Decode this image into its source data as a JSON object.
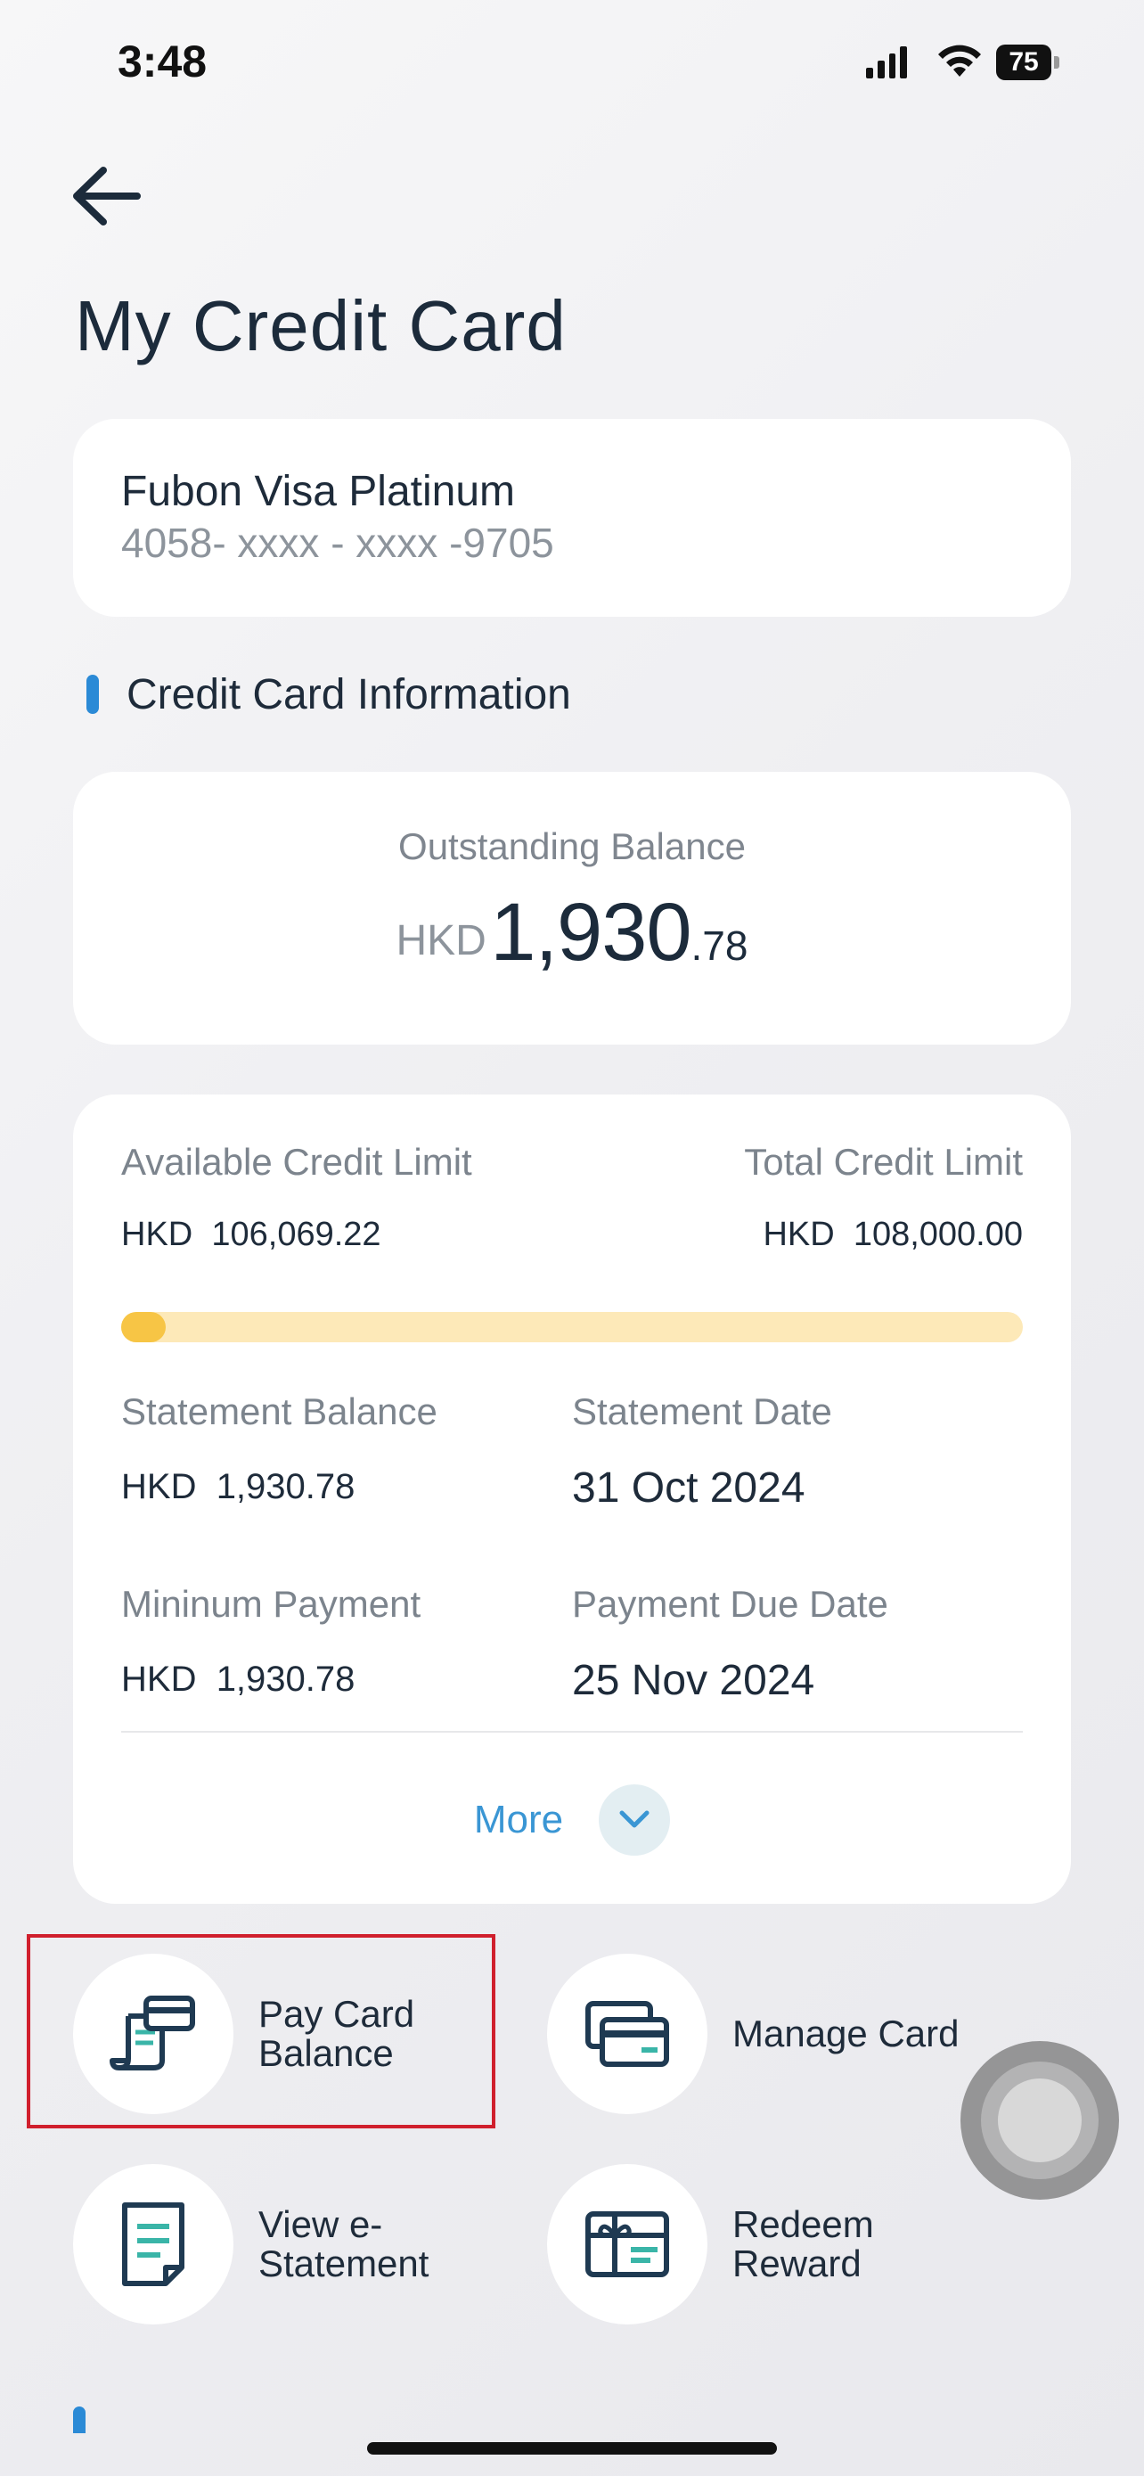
{
  "status_bar": {
    "time": "3:48",
    "battery": "75"
  },
  "header": {
    "title": "My Credit Card"
  },
  "card_selector": {
    "name": "Fubon Visa Platinum",
    "number": "4058- xxxx - xxxx -9705"
  },
  "section": {
    "title": "Credit Card Information"
  },
  "outstanding": {
    "label": "Outstanding Balance",
    "currency": "HKD",
    "integer": "1,930",
    "decimal": ".78"
  },
  "info": {
    "available_label": "Available Credit Limit",
    "available_currency": "HKD",
    "available_value": "106,069.22",
    "total_label": "Total Credit Limit",
    "total_currency": "HKD",
    "total_value": "108,000.00",
    "used_fraction": 0.018,
    "statement_balance_label": "Statement Balance",
    "statement_balance_currency": "HKD",
    "statement_balance_value": "1,930.78",
    "statement_date_label": "Statement Date",
    "statement_date_value": "31 Oct 2024",
    "min_payment_label": "Mininum Payment",
    "min_payment_currency": "HKD",
    "min_payment_value": "1,930.78",
    "due_date_label": "Payment Due Date",
    "due_date_value": "25 Nov 2024",
    "more_label": "More"
  },
  "actions": {
    "pay_card": "Pay Card Balance",
    "manage_card": "Manage Card",
    "view_statement": "View e-Statement",
    "redeem": "Redeem Reward"
  },
  "colors": {
    "accent": "#2b8ad6",
    "progress_fill": "#f7c545",
    "progress_track": "#fde9b8",
    "highlight": "#d01f2d",
    "icon": "#1f3a52",
    "icon_accent": "#3ab5a8"
  }
}
